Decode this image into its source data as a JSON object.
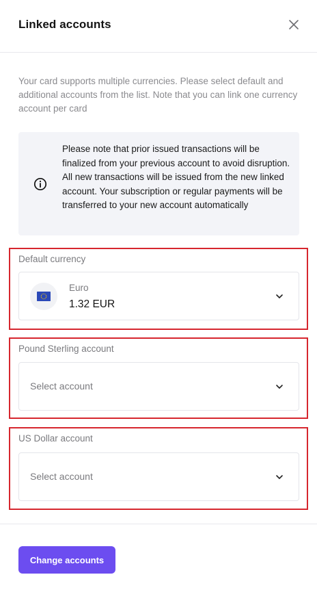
{
  "dialog": {
    "title": "Linked accounts",
    "close_icon": "close-icon"
  },
  "intro": {
    "text": "Your card supports multiple currencies. Please select default and additional accounts from the list. Note that you can link one currency account per card"
  },
  "notice": {
    "icon": "info-icon",
    "text": "Please note that prior issued transactions will be finalized from your previous account to avoid disruption. All new transactions will be issued from the new linked account. Your subscription or regular payments will be transferred to your new account automatically"
  },
  "sections": {
    "default_currency": {
      "label": "Default currency",
      "currency_name": "Euro",
      "balance": "1.32 EUR",
      "flag_icon": "eu-flag-icon"
    },
    "gbp": {
      "label": "Pound Sterling account",
      "placeholder": "Select account"
    },
    "usd": {
      "label": "US Dollar account",
      "placeholder": "Select account"
    }
  },
  "footer": {
    "button_label": "Change accounts"
  },
  "colors": {
    "accent": "#6c4df0",
    "highlight_border": "#d6262e",
    "notice_bg": "#f3f4f8"
  }
}
